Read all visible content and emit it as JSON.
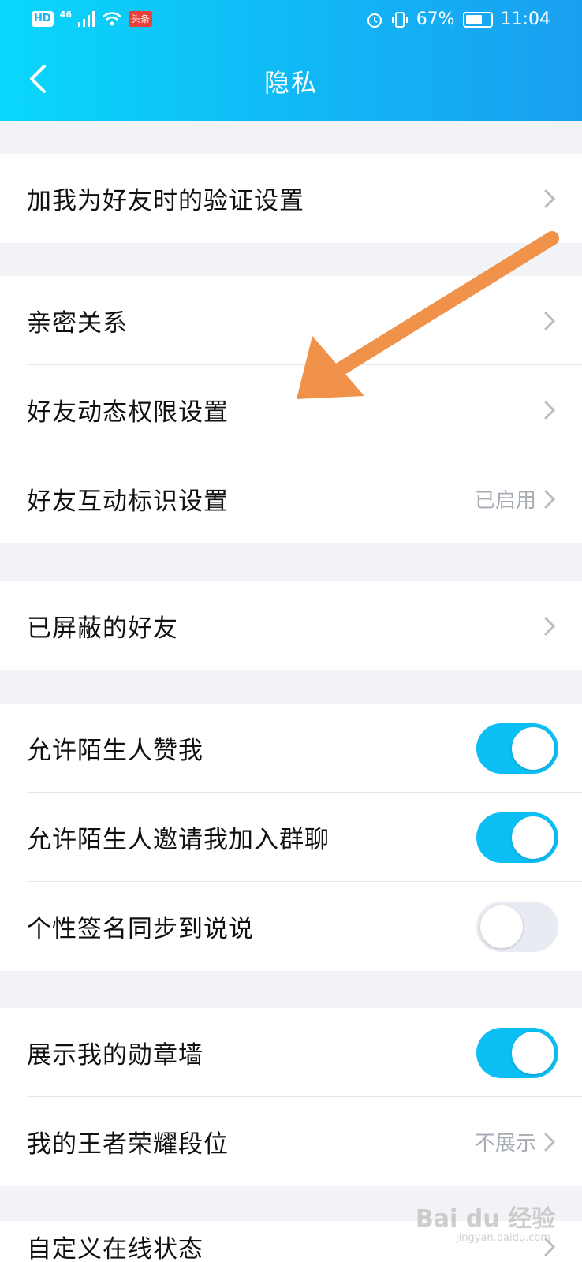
{
  "status_bar": {
    "hd": "HD",
    "network": "46",
    "app_badge": "头条",
    "battery_percent": "67%",
    "time": "11:04"
  },
  "header": {
    "title": "隐私"
  },
  "groups": [
    {
      "items": [
        {
          "label": "加我为好友时的验证设置"
        }
      ]
    },
    {
      "items": [
        {
          "label": "亲密关系"
        },
        {
          "label": "好友动态权限设置"
        },
        {
          "label": "好友互动标识设置",
          "value": "已启用"
        }
      ]
    },
    {
      "items": [
        {
          "label": "已屏蔽的好友"
        }
      ]
    },
    {
      "items": [
        {
          "label": "允许陌生人赞我",
          "toggle": true
        },
        {
          "label": "允许陌生人邀请我加入群聊",
          "toggle": true
        },
        {
          "label": "个性签名同步到说说",
          "toggle": false
        }
      ]
    },
    {
      "items": [
        {
          "label": "展示我的勋章墙",
          "toggle": true
        },
        {
          "label": "我的王者荣耀段位",
          "value": "不展示"
        }
      ]
    },
    {
      "items": [
        {
          "label": "自定义在线状态"
        }
      ]
    }
  ],
  "annotation": {
    "arrow_color": "#f0924a"
  },
  "watermark": {
    "text": "Bai du 经验",
    "sub": "jingyan.baidu.com"
  },
  "colors": {
    "header_start": "#0ad7fb",
    "header_end": "#1aa0f0",
    "toggle_on": "#0bbff5",
    "toggle_off": "#e8ebf1"
  }
}
